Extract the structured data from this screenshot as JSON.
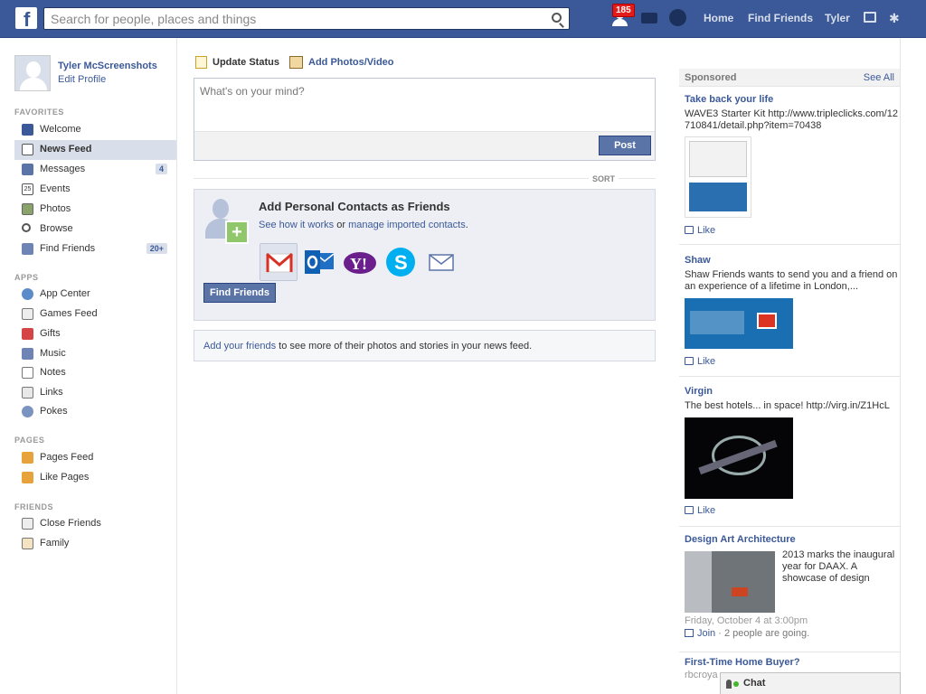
{
  "header": {
    "search_placeholder": "Search for people, places and things",
    "friend_requests_badge": "185",
    "nav": [
      "Home",
      "Find Friends",
      "Tyler"
    ]
  },
  "profile": {
    "name": "Tyler McScreenshots",
    "edit": "Edit Profile"
  },
  "sidebar": {
    "favorites_label": "FAVORITES",
    "favorites": [
      {
        "label": "Welcome",
        "icon": "facebook-icon"
      },
      {
        "label": "News Feed",
        "icon": "news-feed-icon",
        "selected": true
      },
      {
        "label": "Messages",
        "icon": "messages-icon",
        "count": "4"
      },
      {
        "label": "Events",
        "icon": "calendar-icon",
        "icon_text": "25"
      },
      {
        "label": "Photos",
        "icon": "photos-icon"
      },
      {
        "label": "Browse",
        "icon": "search-icon"
      },
      {
        "label": "Find Friends",
        "icon": "find-friends-icon",
        "count": "20+"
      }
    ],
    "apps_label": "APPS",
    "apps": [
      {
        "label": "App Center",
        "icon": "app-center-icon"
      },
      {
        "label": "Games Feed",
        "icon": "games-icon"
      },
      {
        "label": "Gifts",
        "icon": "gift-icon"
      },
      {
        "label": "Music",
        "icon": "music-icon"
      },
      {
        "label": "Notes",
        "icon": "notes-icon"
      },
      {
        "label": "Links",
        "icon": "links-icon"
      },
      {
        "label": "Pokes",
        "icon": "poke-icon"
      }
    ],
    "pages_label": "PAGES",
    "pages": [
      {
        "label": "Pages Feed",
        "icon": "pages-feed-icon"
      },
      {
        "label": "Like Pages",
        "icon": "like-pages-icon"
      }
    ],
    "friends_label": "FRIENDS",
    "friends": [
      {
        "label": "Close Friends",
        "icon": "close-friends-icon"
      },
      {
        "label": "Family",
        "icon": "family-icon"
      }
    ]
  },
  "composer": {
    "tab_status": "Update Status",
    "tab_photo": "Add Photos/Video",
    "placeholder": "What's on your mind?",
    "post": "Post",
    "sort": "SORT"
  },
  "contacts": {
    "title": "Add Personal Contacts as Friends",
    "link1": "See how it works",
    "or": " or ",
    "link2": "manage imported contacts",
    "period": ".",
    "find_button": "Find Friends"
  },
  "add_friends": {
    "link": "Add your friends",
    "text": " to see more of their photos and stories in your news feed."
  },
  "sponsored": {
    "title": "Sponsored",
    "see_all": "See All",
    "like": "Like",
    "ads": [
      {
        "title": "Take back your life",
        "body": "WAVE3 Starter Kit http://www.tripleclicks.com/12710841/detail.php?item=70438"
      },
      {
        "title": "Shaw",
        "body": "Shaw Friends wants to send you and a friend on an experience of a lifetime in London,..."
      },
      {
        "title": "Virgin",
        "body": "The best hotels... in space! http://virg.in/Z1HcL"
      },
      {
        "title": "Design Art Architecture",
        "body": "2013 marks the inaugural year for DAAX. A showcase of design",
        "date": "Friday, October 4 at 3:00pm",
        "join": "Join",
        "going": " · 2 people are going."
      },
      {
        "title": "First-Time Home Buyer?",
        "body": "rbcroya"
      }
    ]
  },
  "chat": {
    "label": "Chat"
  },
  "colors": {
    "brand": "#3b5998",
    "link": "#3b5998",
    "badge": "#e41b1b"
  }
}
